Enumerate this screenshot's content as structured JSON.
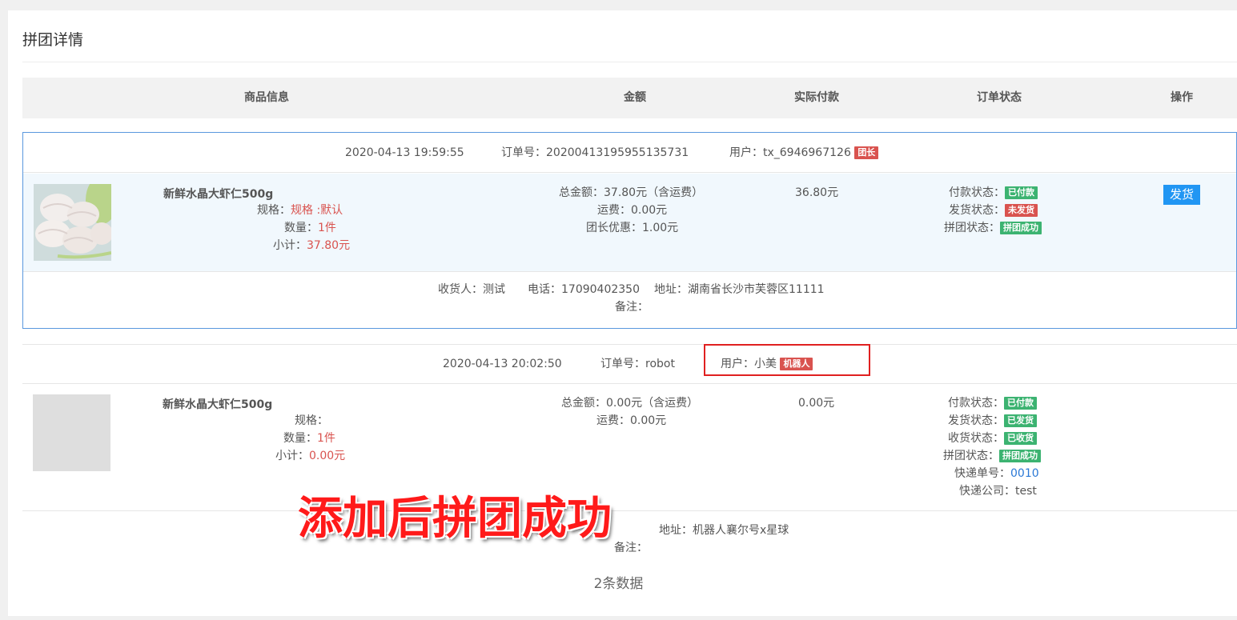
{
  "page": {
    "title": "拼团详情",
    "count_text": "2条数据"
  },
  "table": {
    "headers": [
      "商品信息",
      "金额",
      "实际付款",
      "订单状态",
      "操作"
    ]
  },
  "orders": [
    {
      "time": "2020-04-13 19:59:55",
      "order_no_label": "订单号：",
      "order_no": "20200413195955135731",
      "user_label": "用户：",
      "user": "tx_6946967126",
      "user_tag": "团长",
      "product_name": "新鲜水晶大虾仁500g",
      "spec_label": "规格：",
      "spec": "规格 :默认",
      "qty_label": "数量：",
      "qty": "1件",
      "subtotal_label": "小计：",
      "subtotal": "37.80元",
      "total": "总金额：37.80元（含运费）",
      "freight": "运费：0.00元",
      "discount": "团长优惠：1.00元",
      "paid": "36.80元",
      "pay_status_label": "付款状态：",
      "pay_status": "已付款",
      "ship_status_label": "发货状态：",
      "ship_status": "未发货",
      "group_status_label": "拼团状态：",
      "group_status": "拼团成功",
      "action": "发货",
      "consignee": "收货人：测试",
      "phone": "电话：17090402350",
      "address": "地址：湖南省长沙市芙蓉区11111",
      "remark": "备注："
    },
    {
      "time": "2020-04-13 20:02:50",
      "order_no_label": "订单号：",
      "order_no": "robot",
      "user_label": "用户：",
      "user": "小美",
      "user_tag": "机器人",
      "product_name": "新鲜水晶大虾仁500g",
      "spec_label": "规格：",
      "qty_label": "数量：",
      "qty": "1件",
      "subtotal_label": "小计：",
      "subtotal": "0.00元",
      "total": "总金额：0.00元（含运费）",
      "freight": "运费：0.00元",
      "paid": "0.00元",
      "pay_status_label": "付款状态：",
      "pay_status": "已付款",
      "ship_status_label": "发货状态：",
      "ship_status": "已发货",
      "receive_status_label": "收货状态：",
      "receive_status": "已收货",
      "group_status_label": "拼团状态：",
      "group_status": "拼团成功",
      "tracking_label": "快递单号：",
      "tracking_no": "0010",
      "courier_label": "快递公司：",
      "courier": "test",
      "address": "地址：机器人襄尔号x星球",
      "remark": "备注："
    }
  ],
  "overlay": {
    "caption": "添加后拼团成功"
  },
  "colors": {
    "accent_blue": "#2196f3",
    "tag_red": "#d9534f",
    "tag_green": "#3cb371",
    "highlight_red": "#e02020"
  }
}
